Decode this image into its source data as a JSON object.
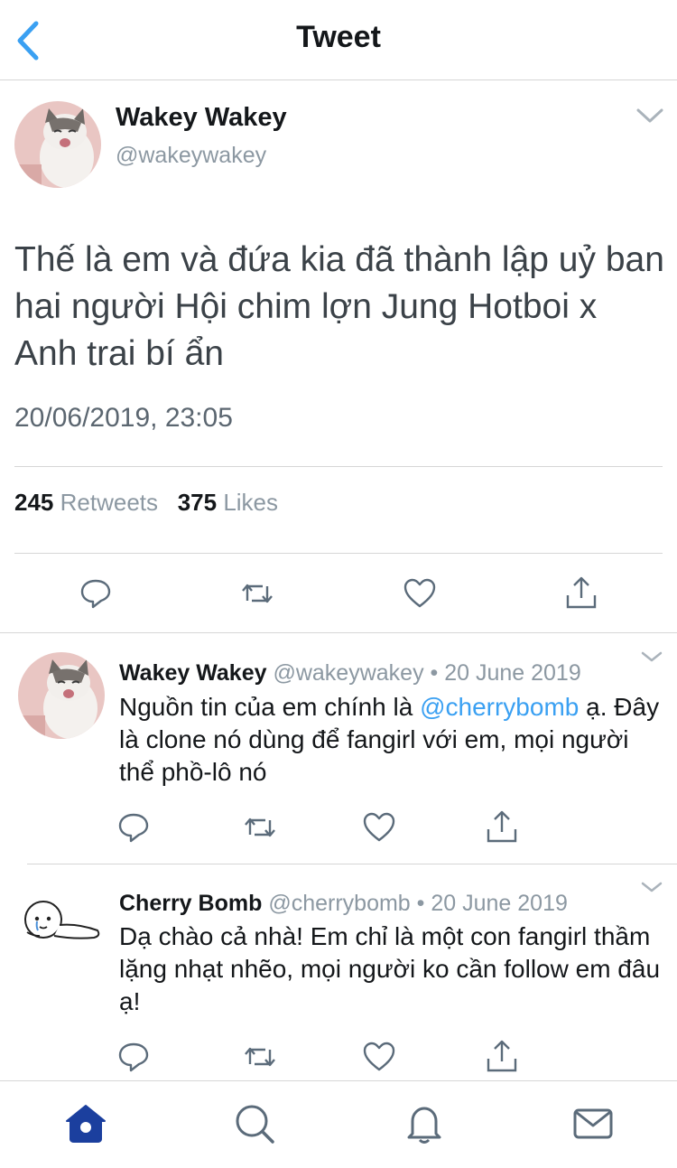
{
  "header": {
    "title": "Tweet",
    "back_icon": "chevron-left-icon"
  },
  "main_tweet": {
    "name": "Wakey Wakey",
    "handle": "@wakeywakey",
    "text": "Thế là em và đứa kia đã thành lập uỷ ban hai người Hội chim lợn Jung Hotboi x Anh trai bí ẩn",
    "timestamp": "20/06/2019, 23:05",
    "retweets_count": "245",
    "retweets_label": "Retweets",
    "likes_count": "375",
    "likes_label": "Likes"
  },
  "replies": [
    {
      "name": "Wakey Wakey",
      "meta": "@wakeywakey • 20 June 2019",
      "text_before": "Nguồn tin của em chính là ",
      "mention": "@cherrybomb",
      "text_after": " ạ. Đây là clone nó dùng để fangirl với em, mọi người thể phồ-lô nó"
    },
    {
      "name": "Cherry Bomb",
      "meta": "@cherrybomb • 20 June 2019",
      "text": "Dạ chào cả nhà! Em chỉ là một con fangirl thầm lặng nhạt nhẽo, mọi người ko cần follow em đâu ạ!"
    }
  ],
  "tabbar": {
    "tabs": [
      "home-icon",
      "search-icon",
      "bell-icon",
      "mail-icon"
    ],
    "active_color": "#1b3f9e"
  },
  "colors": {
    "accent": "#3aa0f2",
    "muted": "#8c98a2",
    "icon": "#5b6b7a"
  }
}
